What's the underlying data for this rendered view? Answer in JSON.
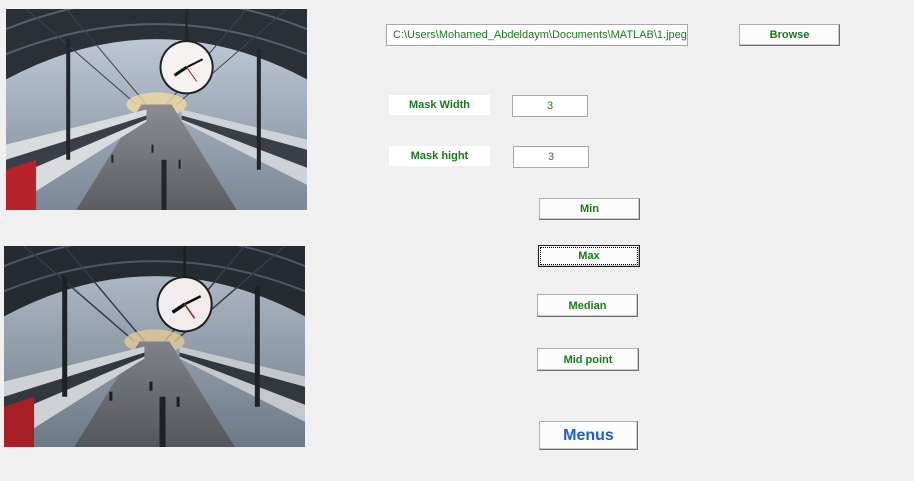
{
  "images": {
    "original_alt": "Original train station image",
    "filtered_alt": "Filtered train station image"
  },
  "file": {
    "path": "C:\\Users\\Mohamed_Abdeldaym\\Documents\\MATLAB\\1.jpeg",
    "browse_label": "Browse"
  },
  "mask": {
    "width_label": "Mask Width",
    "width_value": "3",
    "height_label": "Mask hight",
    "height_value": "3"
  },
  "filters": {
    "min_label": "Min",
    "max_label": "Max",
    "median_label": "Median",
    "midpoint_label": "Mid point"
  },
  "menus_label": "Menus",
  "colors": {
    "text_green": "#1a7a1a",
    "menus_blue": "#1c5fd6",
    "background": "#f0f0f0"
  }
}
